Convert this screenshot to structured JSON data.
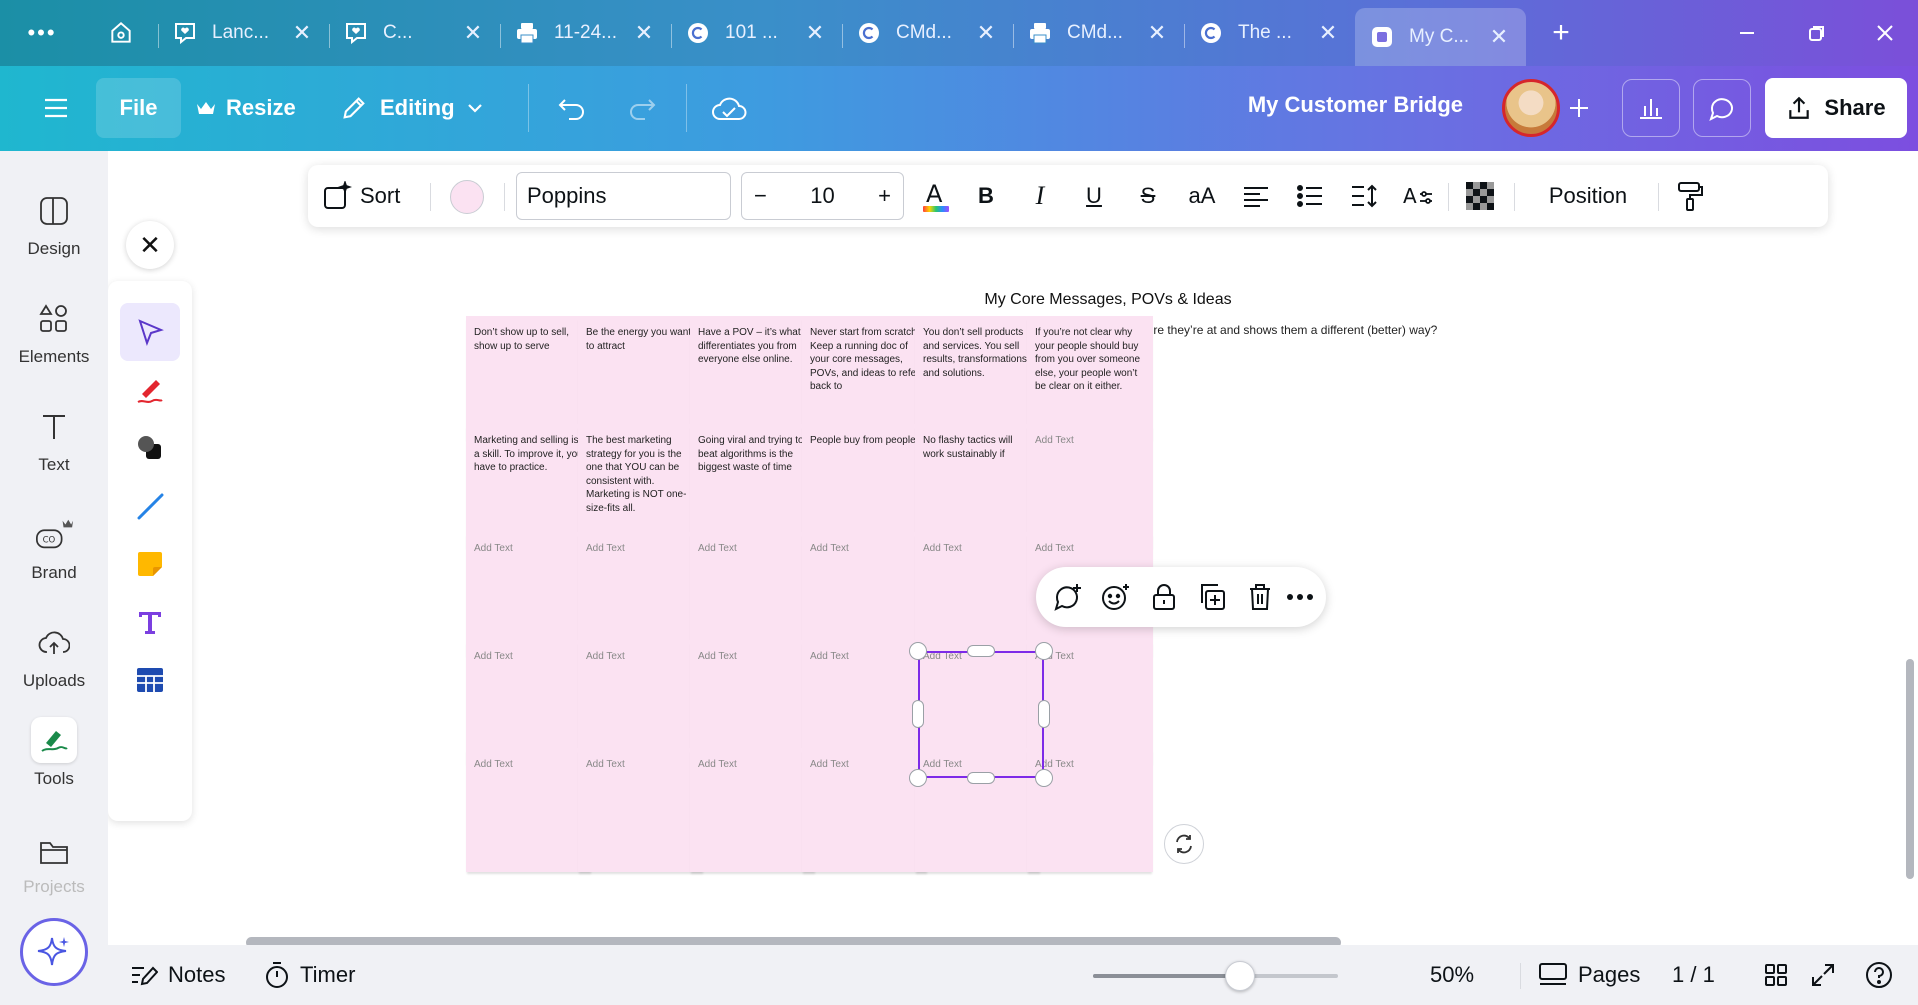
{
  "browser": {
    "tabs": [
      {
        "label": "Lanc...",
        "icon": "heart-chat-icon"
      },
      {
        "label": "C...",
        "icon": "heart-chat-icon"
      },
      {
        "label": "11-24...",
        "icon": "printer-icon"
      },
      {
        "label": "101 ...",
        "icon": "copyright-icon"
      },
      {
        "label": "CMd...",
        "icon": "copyright-icon"
      },
      {
        "label": "CMd...",
        "icon": "printer-icon"
      },
      {
        "label": "The ...",
        "icon": "copyright-icon"
      },
      {
        "label": "My C...",
        "icon": "canva-doc-icon",
        "active": true
      }
    ]
  },
  "header": {
    "file": "File",
    "resize": "Resize",
    "editing": "Editing",
    "doc_title": "My Customer Bridge",
    "share": "Share"
  },
  "rail": {
    "items": [
      "Design",
      "Elements",
      "Text",
      "Brand",
      "Uploads",
      "Tools",
      "Projects"
    ]
  },
  "toolbar": {
    "sort": "Sort",
    "font": "Poppins",
    "size": "10",
    "minus": "−",
    "plus": "+",
    "bold": "B",
    "italic": "I",
    "underline": "U",
    "strike": "S",
    "case": "aA",
    "position": "Position",
    "color_swatch": "#fbe2f2"
  },
  "board": {
    "title": "My Core Messages, POVs & Ideas",
    "subtitle": "What do I say, think, do, believe, or value that meets my audience where they’re at and shows them a different (better) way?",
    "rows": [
      [
        "Don’t show up to sell, show up to serve",
        "Be the energy you want to attract",
        "Have a POV – it’s what differentiates you from everyone else online.",
        "Never start from scratch.  Keep a running doc of your core messages, POVs, and ideas to refer back to",
        "You don’t sell products and services.  You sell results, transformations, and solutions.",
        "If you’re not clear why your people should buy from you over someone else, your people won’t be clear on it either."
      ],
      [
        "Marketing and selling is a skill.  To improve it, you have to practice.",
        "The best marketing strategy for you is the one that YOU can be consistent with. Marketing is NOT one-size-fits all.",
        "Going viral and trying to beat algorithms is the biggest waste of time",
        "People buy from people.",
        "No flashy tactics will work sustainably if",
        "Add Text"
      ],
      [
        "Add Text",
        "Add Text",
        "Add Text",
        "Add Text",
        "Add Text",
        "Add Text"
      ],
      [
        "Add Text",
        "Add Text",
        "Add Text",
        "Add Text",
        "Add Text",
        "Add Text"
      ],
      [
        "Add Text",
        "Add Text",
        "Add Text",
        "Add Text",
        "Add Text",
        "Add Text"
      ]
    ]
  },
  "bottom": {
    "notes": "Notes",
    "timer": "Timer",
    "zoom": "50%",
    "zoom_level": 0.6,
    "pages": "Pages",
    "page_count": "1 / 1"
  }
}
